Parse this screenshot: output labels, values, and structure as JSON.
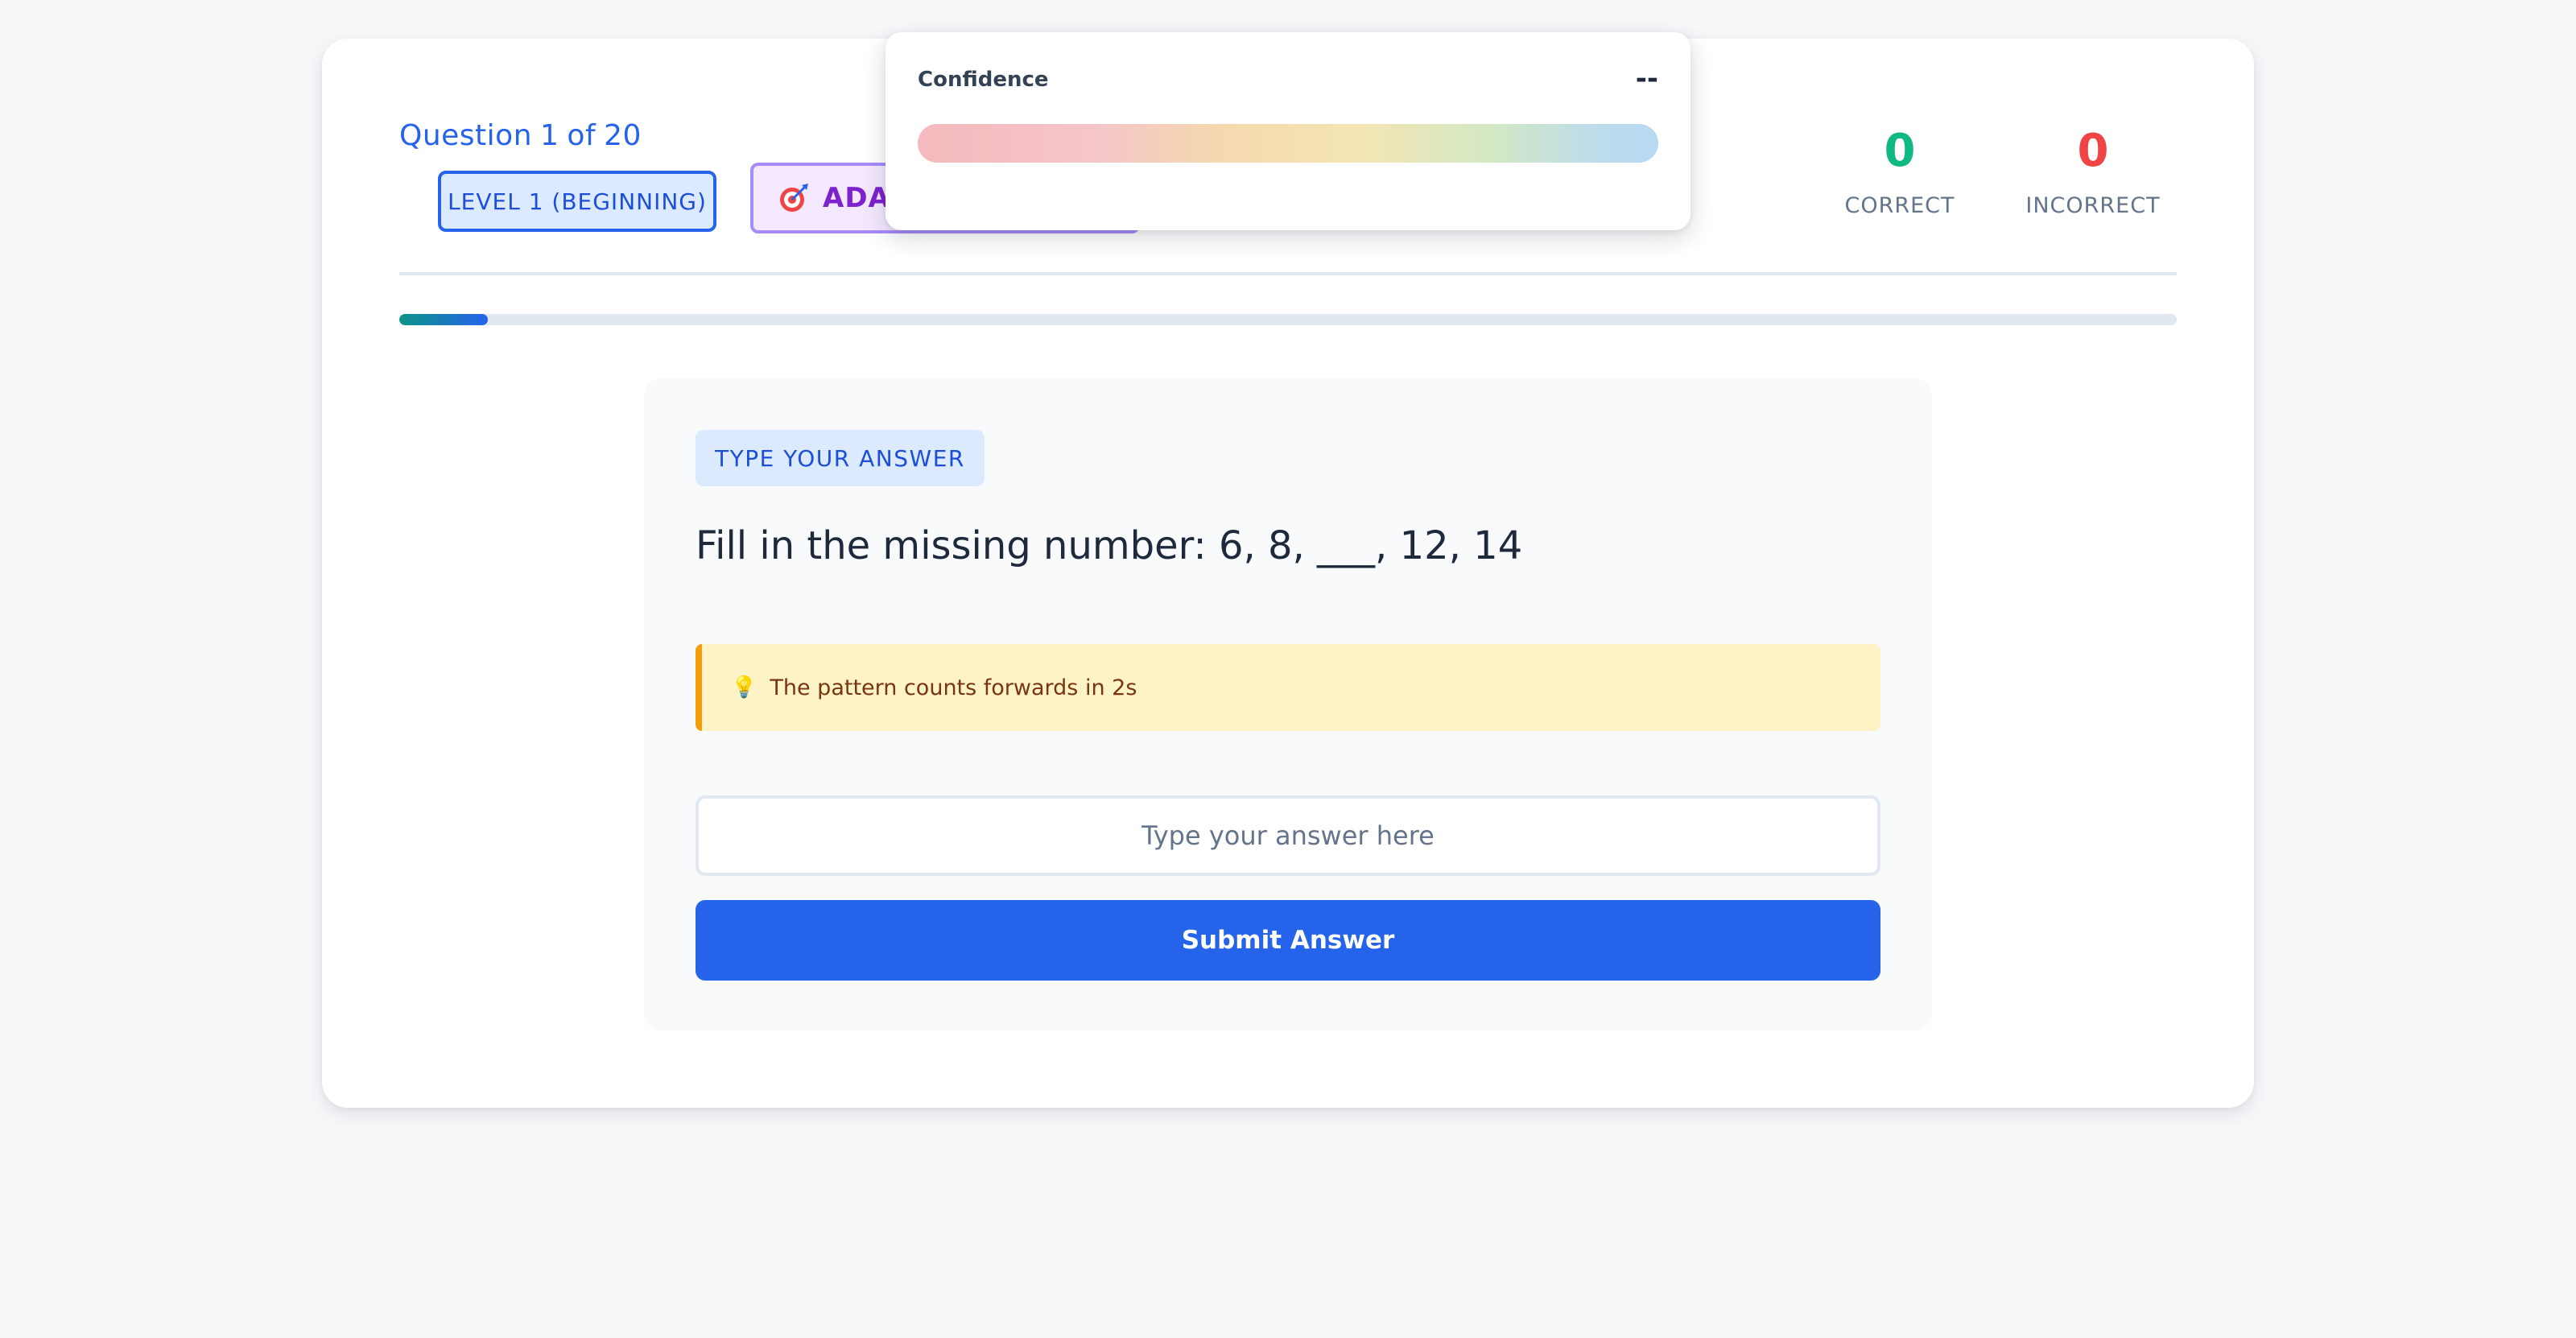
{
  "header": {
    "question_label": "Question",
    "question_current": "1",
    "question_of": "of",
    "question_total": "20",
    "level_badge": "LEVEL 1 (BEGINNING)",
    "adaptive_badge": "ADAPTIVE"
  },
  "scores": {
    "correct_value": "0",
    "correct_label": "CORRECT",
    "incorrect_value": "0",
    "incorrect_label": "INCORRECT"
  },
  "progress": {
    "fraction": 0.05
  },
  "question": {
    "type_chip": "TYPE YOUR ANSWER",
    "text": "Fill in the missing number: 6, 8, ___, 12, 14",
    "hint": "The pattern counts forwards in 2s",
    "hint_icon": "lightbulb-icon",
    "answer_placeholder": "Type your answer here",
    "submit_label": "Submit Answer"
  },
  "confidence": {
    "title": "Confidence",
    "value": "--"
  },
  "colors": {
    "accent": "#2563eb",
    "correct": "#10b981",
    "incorrect": "#ef4444",
    "hint_border": "#f59e0b",
    "adaptive": "#7e22ce"
  }
}
